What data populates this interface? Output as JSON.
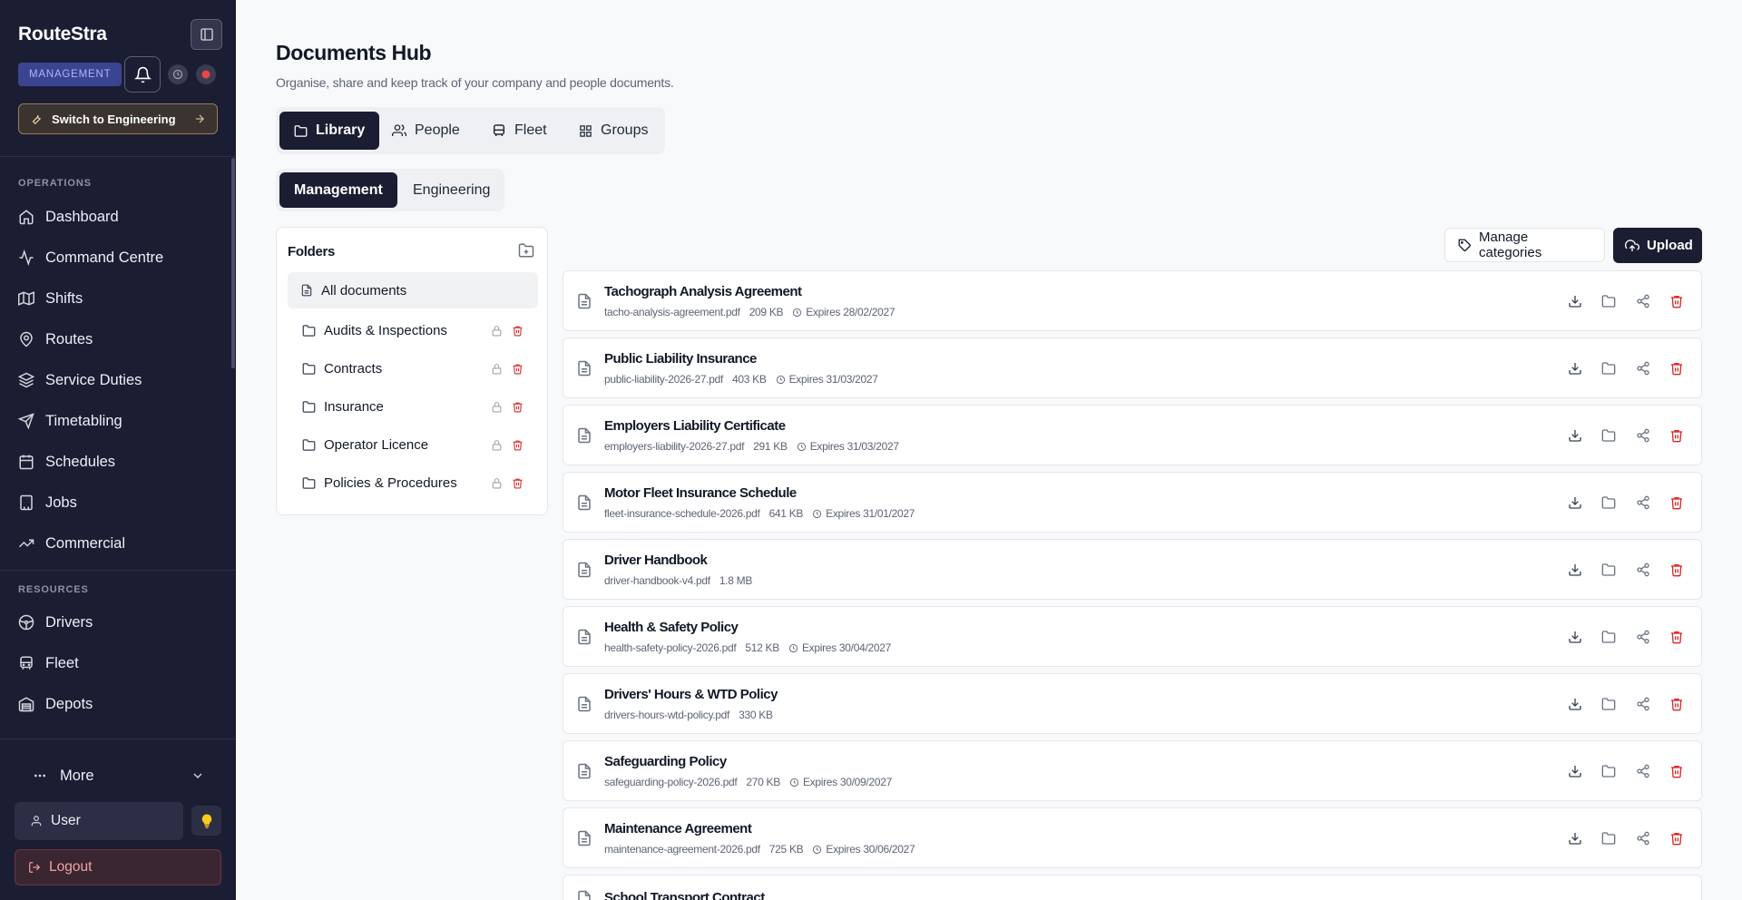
{
  "app": {
    "brand": "RouteStra",
    "role_badge": "MANAGEMENT",
    "switch_label": "Switch to Engineering"
  },
  "sidebar": {
    "sections": [
      {
        "label": "OPERATIONS"
      },
      {
        "label": "RESOURCES"
      }
    ],
    "items": [
      {
        "label": "Dashboard",
        "icon": "home-icon"
      },
      {
        "label": "Command Centre",
        "icon": "activity-icon"
      },
      {
        "label": "Shifts",
        "icon": "map-icon"
      },
      {
        "label": "Routes",
        "icon": "map-pin-icon"
      },
      {
        "label": "Service Duties",
        "icon": "layers-icon"
      },
      {
        "label": "Timetabling",
        "icon": "send-icon"
      },
      {
        "label": "Schedules",
        "icon": "calendar-icon"
      },
      {
        "label": "Jobs",
        "icon": "building-icon"
      },
      {
        "label": "Commercial",
        "icon": "trending-up-icon"
      },
      {
        "label": "Drivers",
        "icon": "steering-wheel-icon"
      },
      {
        "label": "Fleet",
        "icon": "bus-icon"
      },
      {
        "label": "Depots",
        "icon": "warehouse-icon"
      }
    ],
    "more_label": "More",
    "user_label": "User",
    "logout_label": "Logout"
  },
  "page": {
    "title": "Documents Hub",
    "subtitle": "Organise, share and keep track of your company and people documents.",
    "tabs": [
      {
        "label": "Library",
        "icon": "folder-icon",
        "active": true
      },
      {
        "label": "People",
        "icon": "users-icon",
        "active": false
      },
      {
        "label": "Fleet",
        "icon": "bus-icon",
        "active": false
      },
      {
        "label": "Groups",
        "icon": "grid-icon",
        "active": false
      }
    ],
    "subtabs": [
      {
        "label": "Management",
        "active": true
      },
      {
        "label": "Engineering",
        "active": false
      }
    ]
  },
  "folders": {
    "title": "Folders",
    "all_label": "All documents",
    "items": [
      {
        "label": "Audits & Inspections"
      },
      {
        "label": "Contracts"
      },
      {
        "label": "Insurance"
      },
      {
        "label": "Operator Licence"
      },
      {
        "label": "Policies & Procedures"
      }
    ]
  },
  "toolbar": {
    "manage_label": "Manage categories",
    "upload_label": "Upload"
  },
  "documents": [
    {
      "title": "Tachograph Analysis Agreement",
      "file": "tacho-analysis-agreement.pdf",
      "size": "209 KB",
      "expires": "Expires 28/02/2027"
    },
    {
      "title": "Public Liability Insurance",
      "file": "public-liability-2026-27.pdf",
      "size": "403 KB",
      "expires": "Expires 31/03/2027"
    },
    {
      "title": "Employers Liability Certificate",
      "file": "employers-liability-2026-27.pdf",
      "size": "291 KB",
      "expires": "Expires 31/03/2027"
    },
    {
      "title": "Motor Fleet Insurance Schedule",
      "file": "fleet-insurance-schedule-2026.pdf",
      "size": "641 KB",
      "expires": "Expires 31/01/2027"
    },
    {
      "title": "Driver Handbook",
      "file": "driver-handbook-v4.pdf",
      "size": "1.8 MB",
      "expires": ""
    },
    {
      "title": "Health & Safety Policy",
      "file": "health-safety-policy-2026.pdf",
      "size": "512 KB",
      "expires": "Expires 30/04/2027"
    },
    {
      "title": "Drivers' Hours & WTD Policy",
      "file": "drivers-hours-wtd-policy.pdf",
      "size": "330 KB",
      "expires": ""
    },
    {
      "title": "Safeguarding Policy",
      "file": "safeguarding-policy-2026.pdf",
      "size": "270 KB",
      "expires": "Expires 30/09/2027"
    },
    {
      "title": "Maintenance Agreement",
      "file": "maintenance-agreement-2026.pdf",
      "size": "725 KB",
      "expires": "Expires 30/06/2027"
    },
    {
      "title": "School Transport Contract",
      "file": "",
      "size": "",
      "expires": ""
    }
  ],
  "colors": {
    "sidebar_bg": "#1b1d33",
    "accent_dark": "#1b1d33",
    "danger": "#dc2626",
    "badge_bg": "#3b4490",
    "bulb": "#facc15"
  }
}
